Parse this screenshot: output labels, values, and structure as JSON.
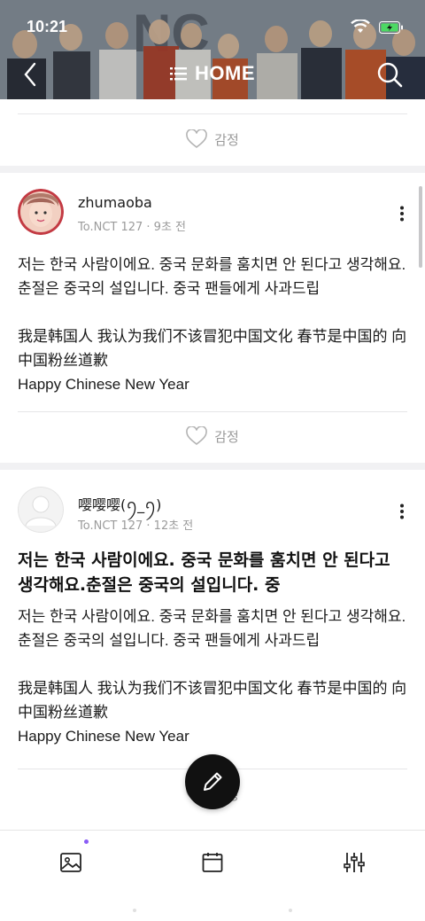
{
  "status_bar": {
    "time": "10:21"
  },
  "nav": {
    "title": "HOME"
  },
  "top_card": {
    "reaction_label": "감정"
  },
  "posts": [
    {
      "username": "zhumaoba",
      "meta": "To.NCT 127 · 9초 전",
      "body": "저는 한국 사람이에요. 중국 문화를 훔치면 안 된다고 생각해요.춘절은 중국의 설입니다. 중국 팬들에게 사과드립\n\n我是韩国人 我认为我们不该冒犯中国文化 春节是中国的 向中国粉丝道歉\nHappy Chinese New Year",
      "reaction_label": "감정"
    },
    {
      "username": "嘤嘤嘤(ꪆ_ꪆ)",
      "meta": "To.NCT 127 · 12초 전",
      "title": "저는 한국 사람이에요. 중국 문화를 훔치면 안 된다고 생각해요.춘절은 중국의 설입니다. 중",
      "body": "저는 한국 사람이에요. 중국 문화를 훔치면 안 된다고 생각해요.춘절은 중국의 설입니다. 중국 팬들에게 사과드립\n\n我是韩国人 我认为我们不该冒犯中国文化 春节是中国的 向中国粉丝道歉\nHappy Chinese New Year",
      "reaction_label": "감정"
    }
  ],
  "icons": {
    "back": "chevron-left-icon",
    "menu": "list-icon",
    "search": "search-icon",
    "heart": "heart-icon",
    "more": "more-vertical-icon",
    "pencil": "pencil-icon",
    "gallery": "image-icon",
    "calendar": "calendar-icon",
    "settings": "sliders-icon"
  },
  "colors": {
    "accent": "#8a5cf6",
    "fab": "#111111",
    "muted": "#9b9b9b"
  }
}
